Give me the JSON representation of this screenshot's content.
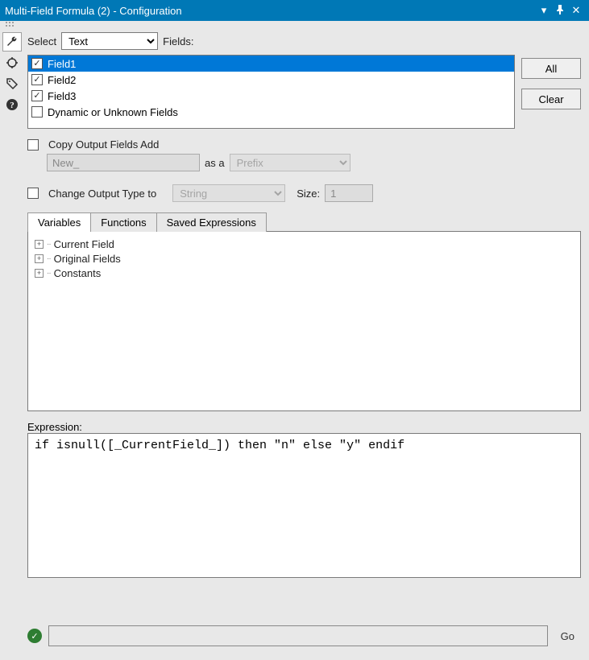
{
  "titlebar": {
    "title": "Multi-Field Formula (2) - Configuration"
  },
  "toolbar": {
    "select_label": "Select",
    "select_value": "Text",
    "select_options": [
      "Text"
    ],
    "fields_label": "Fields:"
  },
  "fields": {
    "items": [
      {
        "label": "Field1",
        "checked": true,
        "selected": true
      },
      {
        "label": "Field2",
        "checked": true,
        "selected": false
      },
      {
        "label": "Field3",
        "checked": true,
        "selected": false
      },
      {
        "label": "Dynamic or Unknown Fields",
        "checked": false,
        "selected": false
      }
    ],
    "all_label": "All",
    "clear_label": "Clear"
  },
  "copyOutput": {
    "checked": false,
    "label": "Copy Output Fields Add",
    "name_value": "New_",
    "as_a_label": "as a",
    "mode_value": "Prefix",
    "mode_options": [
      "Prefix"
    ]
  },
  "changeType": {
    "checked": false,
    "label": "Change Output Type to",
    "type_value": "String",
    "type_options": [
      "String"
    ],
    "size_label": "Size:",
    "size_value": "1"
  },
  "tabs": {
    "items": [
      {
        "label": "Variables",
        "active": true
      },
      {
        "label": "Functions",
        "active": false
      },
      {
        "label": "Saved Expressions",
        "active": false
      }
    ]
  },
  "tree": {
    "items": [
      {
        "label": "Current Field"
      },
      {
        "label": "Original Fields"
      },
      {
        "label": "Constants"
      }
    ]
  },
  "expression": {
    "label": "Expression:",
    "value": "if isnull([_CurrentField_]) then \"n\" else \"y\" endif"
  },
  "footer": {
    "go_label": "Go",
    "status_text": ""
  }
}
